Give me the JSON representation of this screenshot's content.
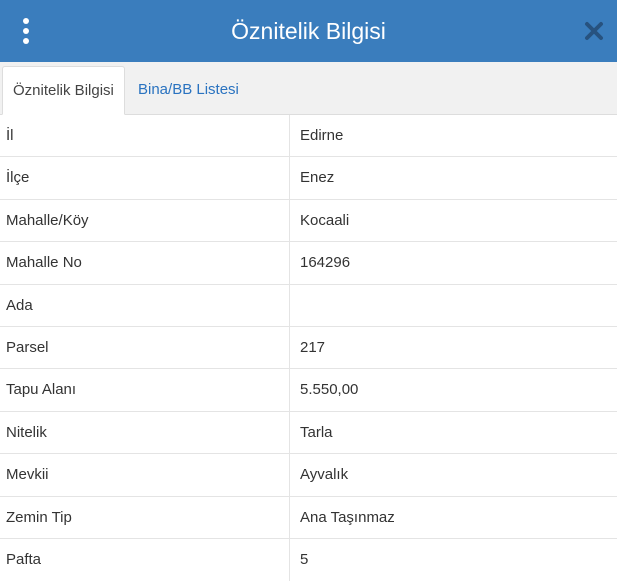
{
  "header": {
    "title": "Öznitelik Bilgisi",
    "menu_icon": "vertical-ellipsis-icon",
    "close_icon": "close-icon",
    "background": "#3a7dbd"
  },
  "tabs": [
    {
      "label": "Öznitelik Bilgisi",
      "active": true
    },
    {
      "label": "Bina/BB Listesi",
      "active": false
    }
  ],
  "attributes": [
    {
      "label": "İl",
      "value": "Edirne"
    },
    {
      "label": "İlçe",
      "value": "Enez"
    },
    {
      "label": "Mahalle/Köy",
      "value": "Kocaali"
    },
    {
      "label": "Mahalle No",
      "value": "164296"
    },
    {
      "label": "Ada",
      "value": ""
    },
    {
      "label": "Parsel",
      "value": "217"
    },
    {
      "label": "Tapu Alanı",
      "value": "5.550,00"
    },
    {
      "label": "Nitelik",
      "value": "Tarla"
    },
    {
      "label": "Mevkii",
      "value": "Ayvalık"
    },
    {
      "label": "Zemin Tip",
      "value": "Ana Taşınmaz"
    },
    {
      "label": "Pafta",
      "value": "5"
    }
  ]
}
